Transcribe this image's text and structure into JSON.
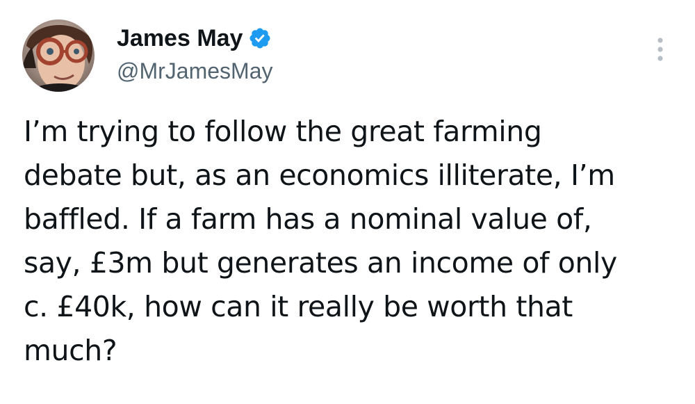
{
  "author": {
    "display_name": "James May",
    "handle": "@MrJamesMay",
    "verified_icon": "verified-badge-icon",
    "avatar_icon": "profile-avatar"
  },
  "menu": {
    "icon": "more-options-icon"
  },
  "tweet": {
    "lines": [
      "I’m trying to follow the great farming",
      "debate but, as an economics illiterate, I’m",
      "baffled. If a farm has a nominal value of,",
      "say, £3m but generates an income of only",
      "c. £40k, how can it really be worth that",
      "much?"
    ]
  },
  "colors": {
    "text": "#0f1419",
    "secondary": "#536471",
    "verified": "#1d9bf0",
    "background": "#ffffff"
  }
}
